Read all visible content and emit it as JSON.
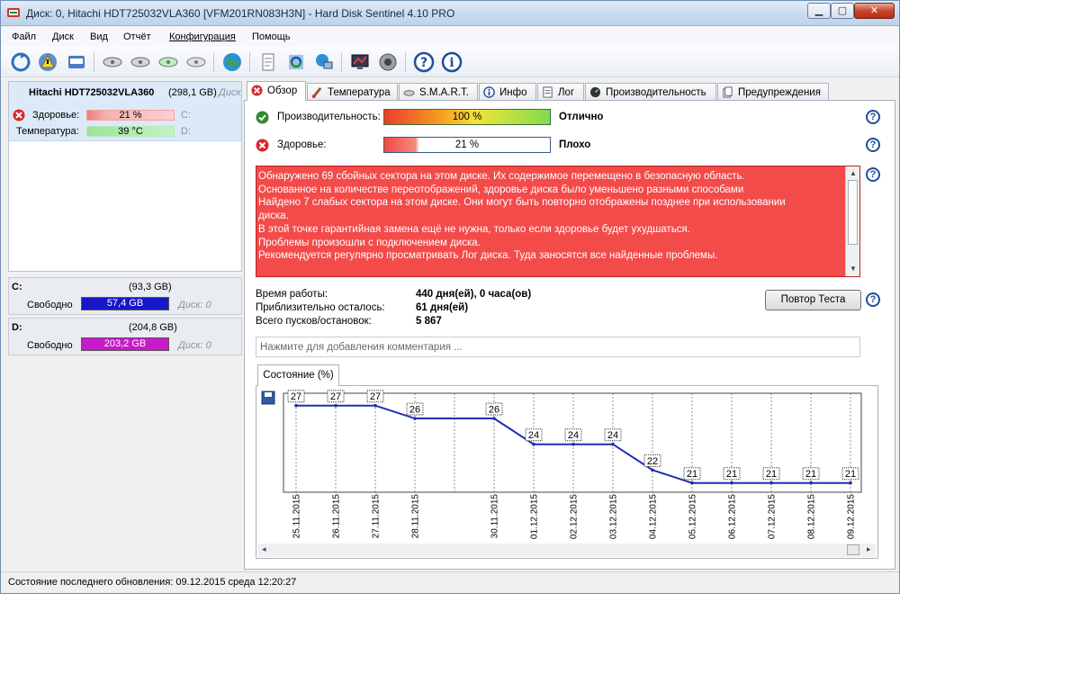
{
  "window": {
    "title": "Диск: 0, Hitachi HDT725032VLA360 [VFM201RN083H3N]  -  Hard Disk Sentinel 4.10 PRO",
    "min": "▁",
    "max": "▢",
    "close": "✕"
  },
  "menu": [
    "Файл",
    "Диск",
    "Вид",
    "Отчёт",
    "Конфигурация",
    "Помощь"
  ],
  "left": {
    "disk": {
      "name": "Hitachi HDT725032VLA360",
      "size": "(298,1 GB)",
      "more": "Диск",
      "health_label": "Здоровье:",
      "health_value": "21 %",
      "health_percent": 21,
      "temp_label": "Температура:",
      "temp_value": "39 °C",
      "drive1": "C:",
      "drive2": "D:"
    },
    "volumes": [
      {
        "name": "C:",
        "size": "(93,3 GB)",
        "free_label": "Свободно",
        "free": "57,4 GB",
        "disk": "Диск: 0",
        "color": "#1717c8"
      },
      {
        "name": "D:",
        "size": "(204,8 GB)",
        "free_label": "Свободно",
        "free": "203,2 GB",
        "disk": "Диск: 0",
        "color": "#c81ac8"
      }
    ]
  },
  "tabs": [
    {
      "label": "Обзор",
      "icon": "error-icon"
    },
    {
      "label": "Температура",
      "icon": "thermometer-icon"
    },
    {
      "label": "S.M.A.R.T.",
      "icon": "smart-icon"
    },
    {
      "label": "Инфо",
      "icon": "info-icon"
    },
    {
      "label": "Лог",
      "icon": "log-icon"
    },
    {
      "label": "Производительность",
      "icon": "performance-icon"
    },
    {
      "label": "Предупреждения",
      "icon": "warnings-icon"
    }
  ],
  "overview": {
    "perf_label": "Производительность:",
    "perf_value": "100 %",
    "perf_percent": 100,
    "perf_eval": "Отлично",
    "health_label": "Здоровье:",
    "health_value": "21 %",
    "health_percent": 21,
    "health_eval": "Плохо",
    "help": "?",
    "messages": [
      "Обнаружено 69 сбойных сектора на этом диске. Их содержимое перемещено в безопасную область.",
      "Основанное на количестве переотображений, здоровье диска было уменьшено разными способами",
      "Найдено 7 слабых сектора на этом диске. Они могут быть повторно отображены позднее при использовании",
      "диска.",
      "В этой точке гарантийная замена ещё не нужна, только если здоровье будет ухудшаться.",
      "Проблемы произошли с подключением диска.",
      "Рекомендуется регулярно просматривать Лог диска. Туда заносятся все найденные проблемы."
    ],
    "uptime_label": "Время работы:",
    "uptime_value": "440 дня(ей), 0 часа(ов)",
    "remain_label": "Приблизительно осталось:",
    "remain_value": "61 дня(ей)",
    "starts_label": "Всего пусков/остановок:",
    "starts_value": "5 867",
    "retest_button": "Повтор Теста",
    "comment_placeholder": "Нажмите для добавления комментария ..."
  },
  "chart_tab": "Состояние (%)",
  "chart_data": {
    "type": "line",
    "x": [
      "25.11.2015",
      "26.11.2015",
      "27.11.2015",
      "28.11.2015",
      "30.11.2015",
      "01.12.2015",
      "02.12.2015",
      "03.12.2015",
      "04.12.2015",
      "05.12.2015",
      "06.12.2015",
      "07.12.2015",
      "08.12.2015",
      "09.12.2015"
    ],
    "x_days": [
      0,
      1,
      2,
      3,
      5,
      6,
      7,
      8,
      9,
      10,
      11,
      12,
      13,
      14
    ],
    "values": [
      27,
      27,
      27,
      26,
      26,
      24,
      24,
      24,
      22,
      21,
      21,
      21,
      21,
      21
    ],
    "ylim": [
      20.7,
      27.4
    ],
    "line_color": "#1c2fb4",
    "grid": true
  },
  "status": "Состояние последнего обновления: 09.12.2015 среда 12:20:27"
}
